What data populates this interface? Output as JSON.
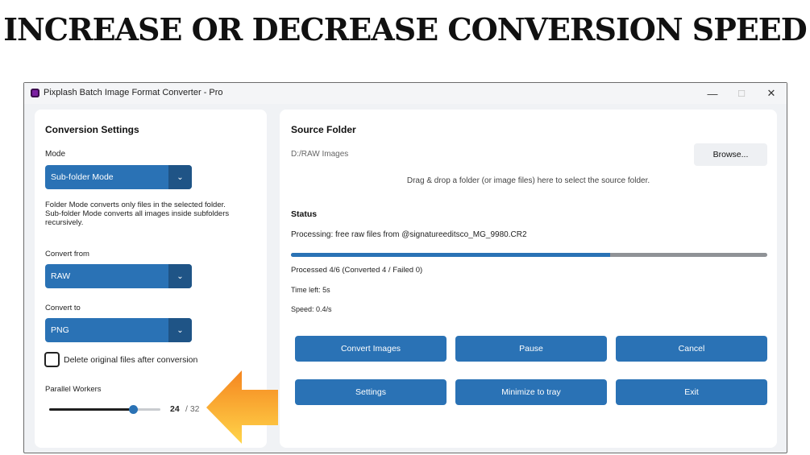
{
  "headline": "INCREASE OR DECREASE CONVERSION SPEED",
  "window": {
    "title": "Pixplash Batch Image Format Converter - Pro",
    "controls": {
      "minimize": "—",
      "maximize": "☐",
      "close": "✕"
    }
  },
  "settings": {
    "heading": "Conversion Settings",
    "mode_label": "Mode",
    "mode_value": "Sub-folder Mode",
    "mode_help_1": "Folder Mode converts only files in the selected folder.",
    "mode_help_2": "Sub-folder Mode converts all images inside subfolders",
    "mode_help_3": "recursively.",
    "convert_from_label": "Convert from",
    "convert_from_value": "RAW",
    "convert_to_label": "Convert to",
    "convert_to_value": "PNG",
    "delete_label": "Delete original files after conversion",
    "delete_checked": false,
    "workers_label": "Parallel Workers",
    "workers_value": "24",
    "workers_max": "/ 32",
    "workers_fraction": 0.75,
    "dropdown_arrow": "⌄"
  },
  "source": {
    "heading": "Source Folder",
    "path": "D:/RAW Images",
    "browse_label": "Browse...",
    "drop_hint": "Drag & drop a folder (or image files) here to select the source folder."
  },
  "status": {
    "heading": "Status",
    "processing": "Processing: free raw files from @signatureeditsco_MG_9980.CR2",
    "progress_fraction": 0.67,
    "processed": "Processed 4/6 (Converted 4 / Failed 0)",
    "time_left": "Time left: 5s",
    "speed": "Speed: 0.4/s"
  },
  "buttons": {
    "convert": "Convert Images",
    "pause": "Pause",
    "cancel": "Cancel",
    "settings": "Settings",
    "minimize_tray": "Minimize to tray",
    "exit": "Exit"
  },
  "colors": {
    "accent": "#2a72b5",
    "accent_dark": "#1f5486",
    "arrow_top": "#f5851f",
    "arrow_bottom": "#ffd54a"
  }
}
